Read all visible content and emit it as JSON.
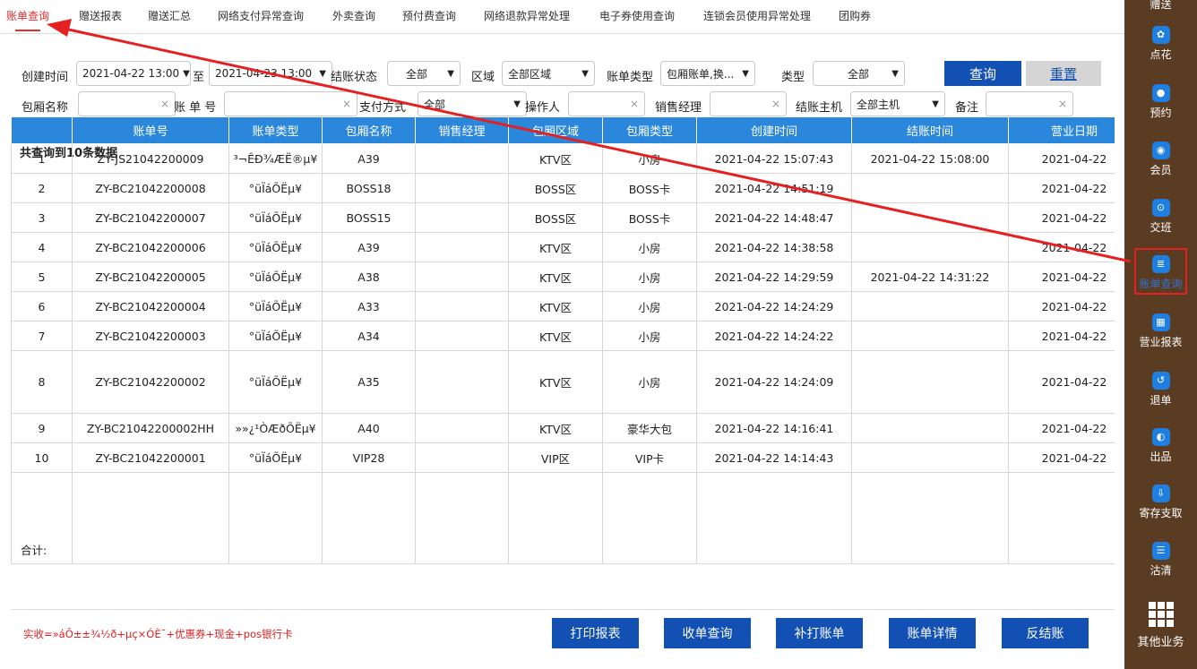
{
  "tabs": [
    "账单查询",
    "赠送报表",
    "赠送汇总",
    "网络支付异常查询",
    "外卖查询",
    "预付费查询",
    "网络退款异常处理",
    "电子券使用查询",
    "连锁会员使用异常处理",
    "团购券"
  ],
  "filters": {
    "create_time_label": "创建时间",
    "start_time": "2021-04-22 13:00",
    "to_label": "至",
    "end_time": "2021-04-23 13:00",
    "settle_status_label": "结账状态",
    "settle_status": "全部",
    "area_label": "区域",
    "area": "全部区域",
    "bill_type_label": "账单类型",
    "bill_type": "包厢账单,换...",
    "type_label": "类型",
    "type": "全部",
    "query_btn": "查询",
    "reset_btn": "重置",
    "room_name_label": "包厢名称",
    "bill_no_label": "账 单 号",
    "pay_method_label": "支付方式",
    "pay_method": "全部",
    "operator_label": "操作人",
    "sales_mgr_label": "销售经理",
    "host_label": "结账主机",
    "host": "全部主机",
    "note_label": "备注",
    "clear": "×",
    "caret": "▼"
  },
  "result_count": "共查询到10条数据",
  "table": {
    "headers": [
      "",
      "账单号",
      "账单类型",
      "包厢名称",
      "销售经理",
      "包厢区域",
      "包厢类型",
      "创建时间",
      "结账时间",
      "营业日期"
    ],
    "rows": [
      [
        "1",
        "ZY-JS21042200009",
        "³¬ÊÐ¾ÆË®µ¥",
        "A39",
        "",
        "KTV区",
        "小房",
        "2021-04-22 15:07:43",
        "2021-04-22 15:08:00",
        "2021-04-22"
      ],
      [
        "2",
        "ZY-BC21042200008",
        "°üÏáÕËµ¥",
        "BOSS18",
        "",
        "BOSS区",
        "BOSS卡",
        "2021-04-22 14:51:19",
        "",
        "2021-04-22"
      ],
      [
        "3",
        "ZY-BC21042200007",
        "°üÏáÕËµ¥",
        "BOSS15",
        "",
        "BOSS区",
        "BOSS卡",
        "2021-04-22 14:48:47",
        "",
        "2021-04-22"
      ],
      [
        "4",
        "ZY-BC21042200006",
        "°üÏáÕËµ¥",
        "A39",
        "",
        "KTV区",
        "小房",
        "2021-04-22 14:38:58",
        "",
        "2021-04-22"
      ],
      [
        "5",
        "ZY-BC21042200005",
        "°üÏáÕËµ¥",
        "A38",
        "",
        "KTV区",
        "小房",
        "2021-04-22 14:29:59",
        "2021-04-22 14:31:22",
        "2021-04-22"
      ],
      [
        "6",
        "ZY-BC21042200004",
        "°üÏáÕËµ¥",
        "A33",
        "",
        "KTV区",
        "小房",
        "2021-04-22 14:24:29",
        "",
        "2021-04-22"
      ],
      [
        "7",
        "ZY-BC21042200003",
        "°üÏáÕËµ¥",
        "A34",
        "",
        "KTV区",
        "小房",
        "2021-04-22 14:24:22",
        "",
        "2021-04-22"
      ],
      [
        "8",
        "ZY-BC21042200002",
        "°üÏáÕËµ¥",
        "A35",
        "",
        "KTV区",
        "小房",
        "2021-04-22 14:24:09",
        "",
        "2021-04-22"
      ],
      [
        "9",
        "ZY-BC21042200002HH",
        "»»¿¹ÒÆðÕËµ¥",
        "A40",
        "",
        "KTV区",
        "豪华大包",
        "2021-04-22 14:16:41",
        "",
        "2021-04-22"
      ],
      [
        "10",
        "ZY-BC21042200001",
        "°üÏáÕËµ¥",
        "VIP28",
        "",
        "VIP区",
        "VIP卡",
        "2021-04-22 14:14:43",
        "",
        "2021-04-22"
      ]
    ],
    "total_label": "合计:"
  },
  "footer": {
    "formula": "实收=»áÔ±±¾½ð+µç×ÓÈ¯+优惠券+现金+pos银行卡",
    "buttons": [
      "打印报表",
      "收单查询",
      "补打账单",
      "账单详情",
      "反结账"
    ]
  },
  "sidebar": {
    "items": [
      "赠送",
      "点花",
      "预约",
      "会员",
      "交班",
      "账单查询",
      "营业报表",
      "退单",
      "出品",
      "寄存支取",
      "沽清",
      "其他业务"
    ]
  }
}
